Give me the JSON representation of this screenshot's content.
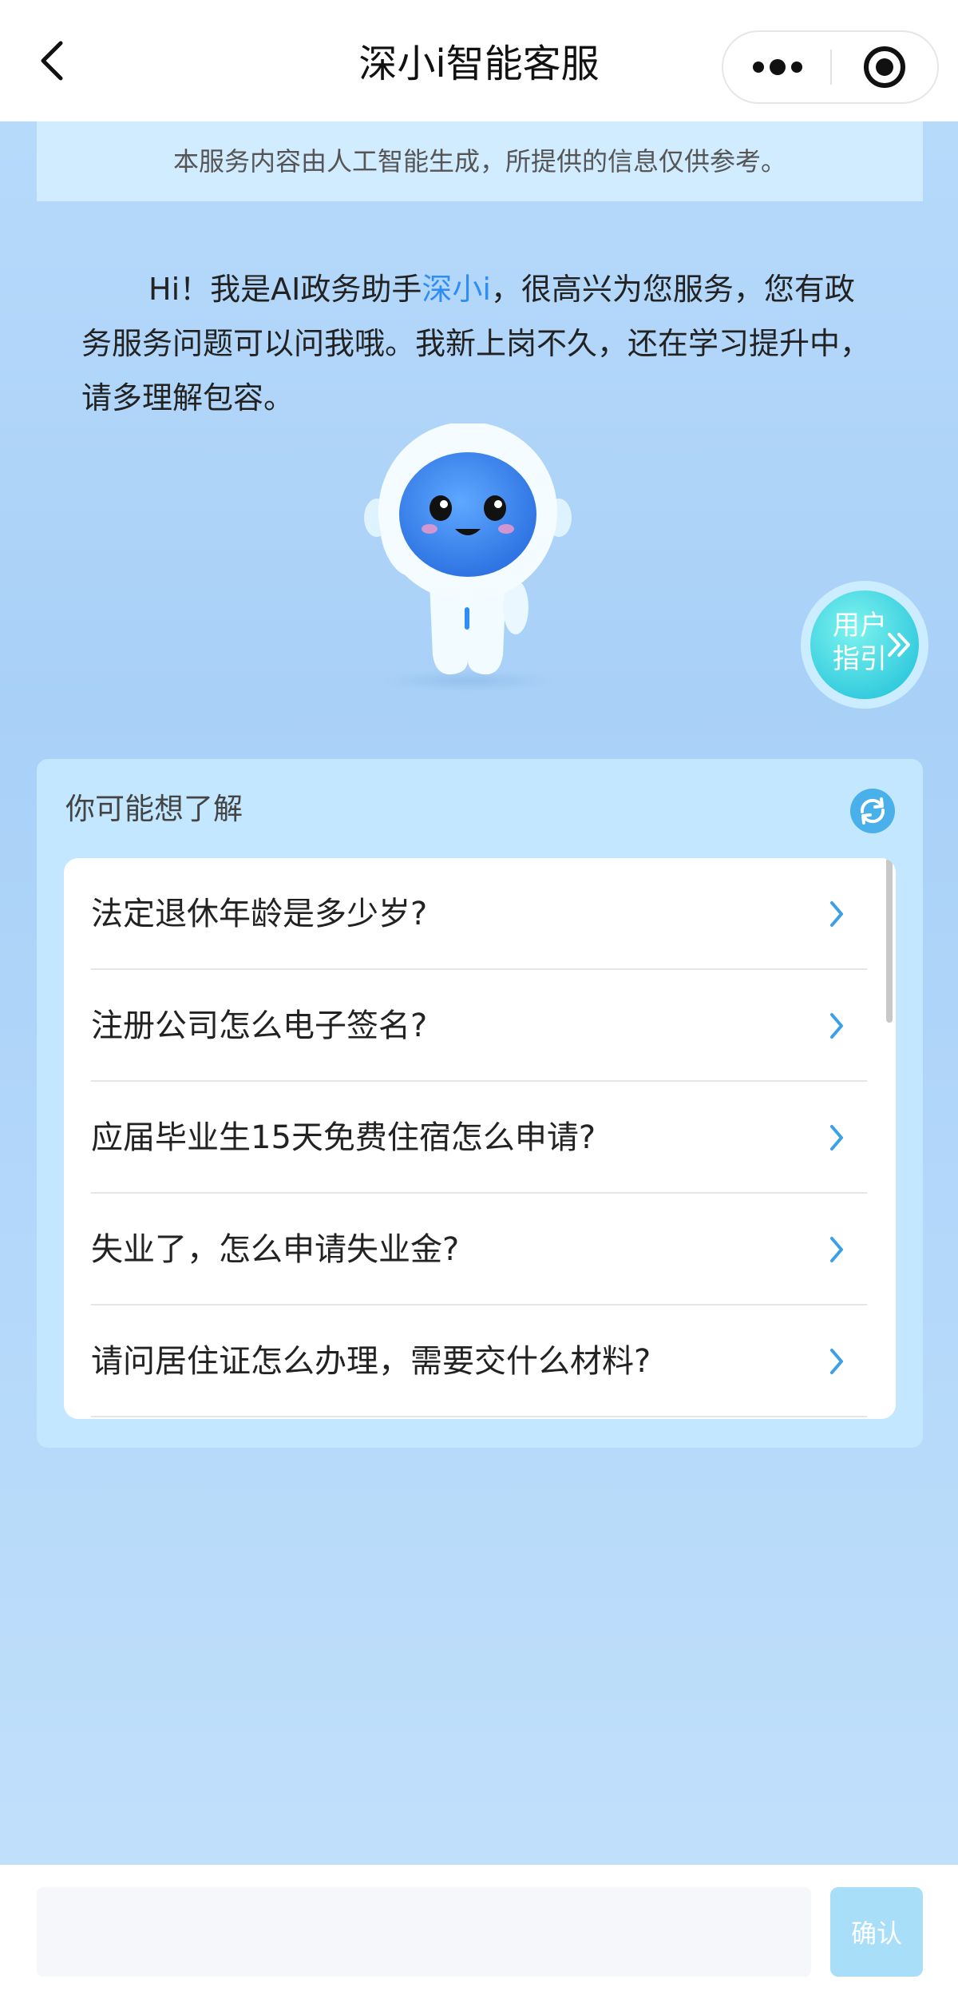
{
  "header": {
    "title": "深小i智能客服",
    "icons": [
      "back-arrow-icon",
      "more-dots-icon",
      "close-target-icon"
    ]
  },
  "disclaimer": "本服务内容由人工智能生成，所提供的信息仅供参考。",
  "greeting": {
    "before": "Hi！我是AI政务助手",
    "highlight": "深小i",
    "after": "，很高兴为您服务，您有政务服务问题可以问我哦。我新上岗不久，还在学习提升中，请多理解包容。"
  },
  "guide": {
    "label": "用户指引",
    "icon": "double-chevron-right-icon"
  },
  "suggestions": {
    "title": "你可能想了解",
    "refresh_icon": "refresh-icon",
    "items": [
      {
        "text": "法定退休年龄是多少岁?"
      },
      {
        "text": "注册公司怎么电子签名?"
      },
      {
        "text": "应届毕业生15天免费住宿怎么申请?"
      },
      {
        "text": "失业了，怎么申请失业金?"
      },
      {
        "text": "请问居住证怎么办理，需要交什么材料?"
      }
    ]
  },
  "input": {
    "value": "",
    "placeholder": ""
  },
  "confirm_label": "确认",
  "colors": {
    "accent": "#2f8ef5",
    "chevron": "#3aa0e8",
    "confirm_bg": "#a9def9"
  }
}
